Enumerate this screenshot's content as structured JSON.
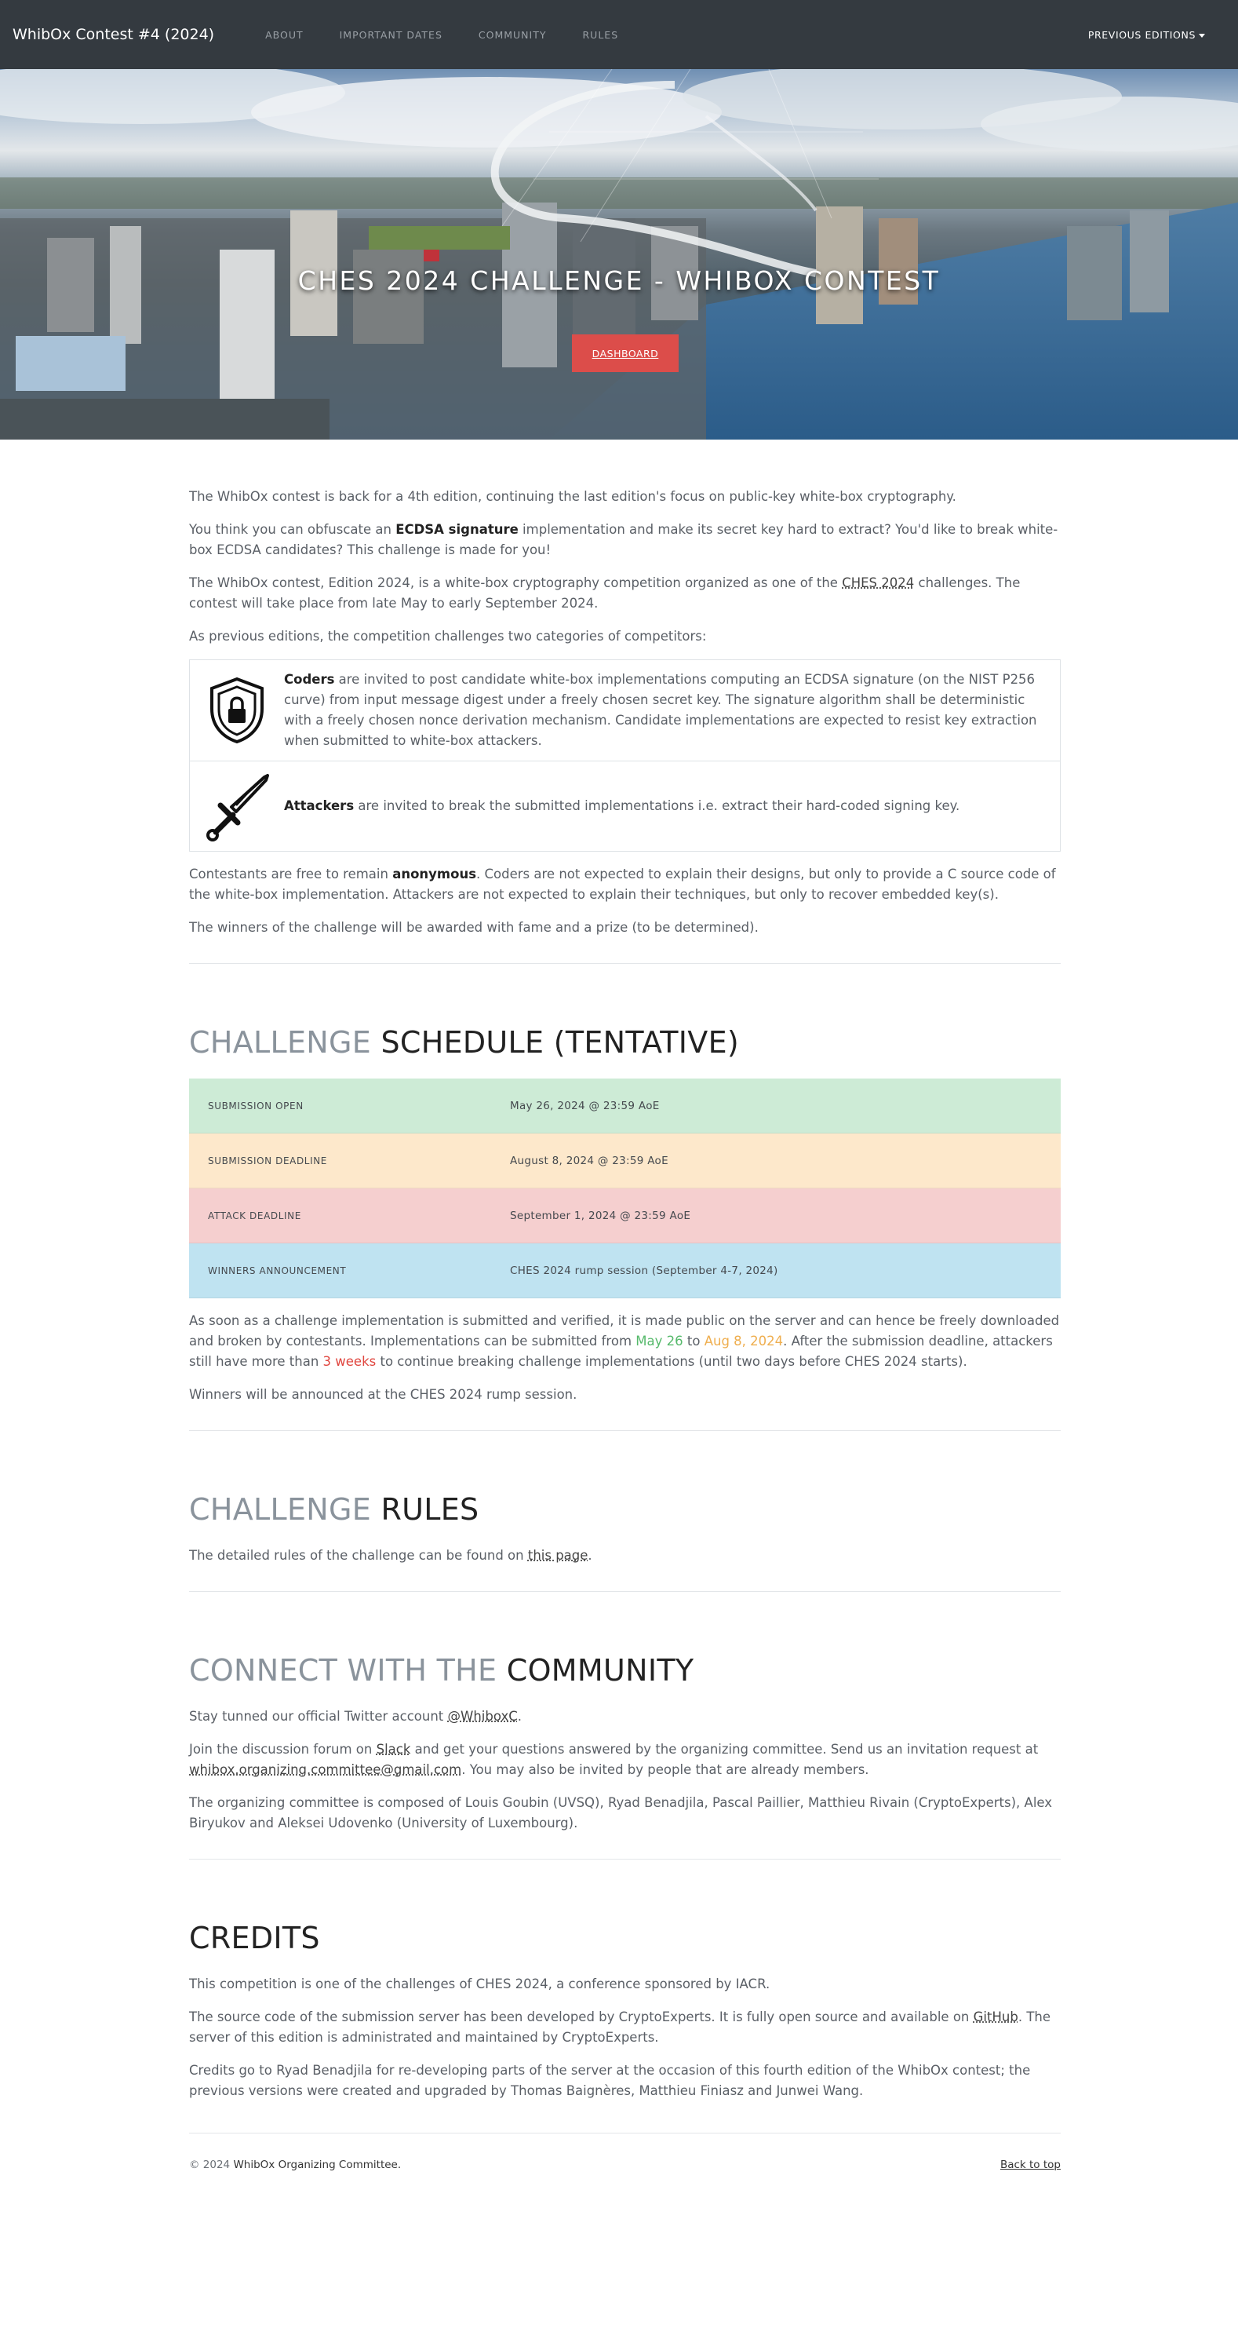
{
  "navbar": {
    "brand": "WhibOx Contest #4 (2024)",
    "links": [
      "ABOUT",
      "IMPORTANT DATES",
      "COMMUNITY",
      "RULES"
    ],
    "previous_editions": "PREVIOUS EDITIONS"
  },
  "hero": {
    "title": "CHES 2024 CHALLENGE - WHIBOX CONTEST",
    "button": "DASHBOARD"
  },
  "about": {
    "p1": "The WhibOx contest is back for a 4th edition, continuing the last edition's focus on public-key white-box cryptography.",
    "p2_a": "You think you can obfuscate an ",
    "p2_strong": "ECDSA signature",
    "p2_b": " implementation and make its secret key hard to extract? You'd like to break white-box ECDSA candidates? This challenge is made for you!",
    "p3_a": "The WhibOx contest, Edition 2024, is a white-box cryptography competition organized as one of the ",
    "p3_link": "CHES 2024",
    "p3_b": " challenges. The contest will take place from late May to early September 2024.",
    "p4": "As previous editions, the competition challenges two categories of competitors:",
    "coders_strong": "Coders",
    "coders_text": " are invited to post candidate white-box implementations computing an ECDSA signature (on the NIST P256 curve) from input message digest under a freely chosen secret key. The signature algorithm shall be deterministic with a freely chosen nonce derivation mechanism. Candidate implementations are expected to resist key extraction when submitted to white-box attackers.",
    "attackers_strong": "Attackers",
    "attackers_text": " are invited to break the submitted implementations i.e. extract their hard-coded signing key.",
    "p5_a": "Contestants are free to remain ",
    "p5_strong": "anonymous",
    "p5_b": ". Coders are not expected to explain their designs, but only to provide a C source code of the white-box implementation. Attackers are not expected to explain their techniques, but only to recover embedded key(s).",
    "p6": "The winners of the challenge will be awarded with fame and a prize (to be determined)."
  },
  "schedule": {
    "title_muted": "CHALLENGE",
    "title_main": "SCHEDULE (TENTATIVE)",
    "rows": [
      {
        "label": "SUBMISSION OPEN",
        "value": "May 26, 2024 @ 23:59 AoE",
        "color": "#cdebd6"
      },
      {
        "label": "SUBMISSION DEADLINE",
        "value": "August 8, 2024 @ 23:59 AoE",
        "color": "#fde8cb"
      },
      {
        "label": "ATTACK DEADLINE",
        "value": "September 1, 2024 @ 23:59 AoE",
        "color": "#f5cfcf"
      },
      {
        "label": "WINNERS ANNOUNCEMENT",
        "value": "CHES 2024 rump session (September 4-7, 2024)",
        "color": "#bfe3f1"
      }
    ],
    "p1_a": "As soon as a challenge implementation is submitted and verified, it is made public on the server and can hence be freely downloaded and broken by contestants. Implementations can be submitted from ",
    "p1_green": "May 26",
    "p1_b": " to ",
    "p1_orange": "Aug 8, 2024",
    "p1_c": ". After the submission deadline, attackers still have more than ",
    "p1_red": "3 weeks",
    "p1_d": " to continue breaking challenge implementations (until two days before CHES 2024 starts).",
    "p2": "Winners will be announced at the CHES 2024 rump session."
  },
  "rules": {
    "title_muted": "CHALLENGE",
    "title_main": "RULES",
    "p1_a": "The detailed rules of the challenge can be found on ",
    "p1_link": "this page",
    "p1_b": "."
  },
  "community": {
    "title_muted": "CONNECT WITH THE",
    "title_main": "COMMUNITY",
    "p1_a": "Stay tunned our official Twitter account ",
    "p1_link": "@WhiboxC",
    "p1_b": ".",
    "p2_a": "Join the discussion forum on ",
    "p2_link": "Slack",
    "p2_b": " and get your questions answered by the organizing committee. Send us an invitation request at ",
    "p2_email": "whibox.organizing.committee@gmail.com",
    "p2_c": ". You may also be invited by people that are already members.",
    "p3": "The organizing committee is composed of Louis Goubin (UVSQ), Ryad Benadjila, Pascal Paillier, Matthieu Rivain (CryptoExperts), Alex Biryukov and Aleksei Udovenko (University of Luxembourg)."
  },
  "credits": {
    "title": "CREDITS",
    "p1": "This competition is one of the challenges of CHES 2024, a conference sponsored by IACR.",
    "p2_a": "The source code of the submission server has been developed by CryptoExperts. It is fully open source and available on ",
    "p2_link": "GitHub",
    "p2_b": ". The server of this edition is administrated and maintained by CryptoExperts.",
    "p3": "Credits go to Ryad Benadjila for re-developing parts of the server at the occasion of this fourth edition of the WhibOx contest; the previous versions were created and upgraded by Thomas Baignères, Matthieu Finiasz and Junwei Wang."
  },
  "footer": {
    "copyright": "© 2024 ",
    "committee": "WhibOx Organizing Committee.",
    "back_to_top": "Back to top"
  },
  "icons": {
    "shield": "shield-lock-icon",
    "sword": "sword-icon"
  }
}
